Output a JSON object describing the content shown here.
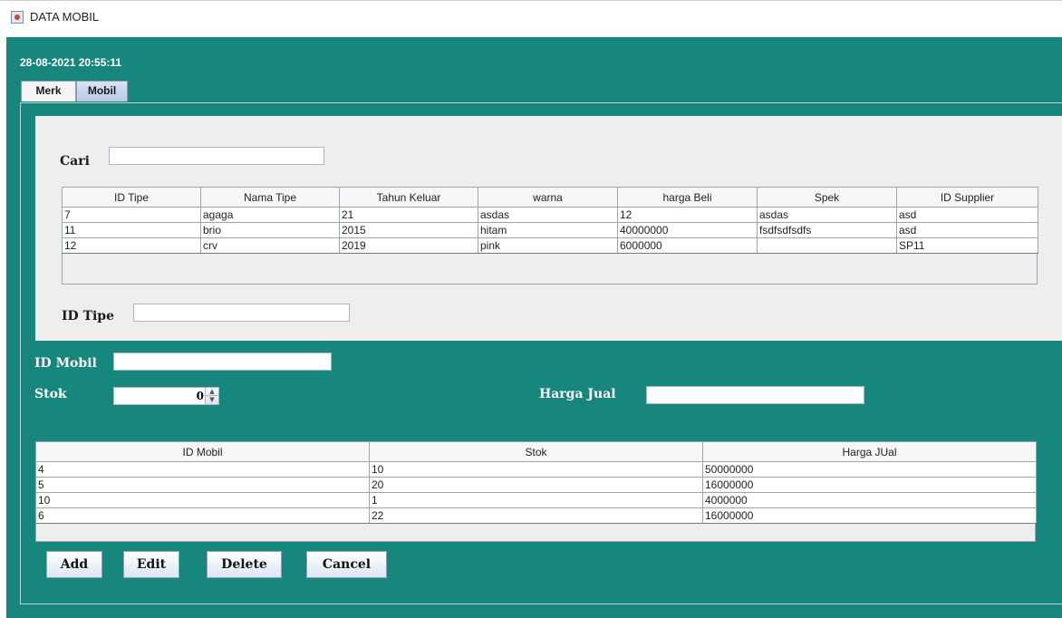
{
  "window": {
    "title": "DATA MOBIL"
  },
  "datetime": "28-08-2021 20:55:11",
  "tabs": [
    {
      "label": "Merk"
    },
    {
      "label": "Mobil"
    }
  ],
  "search": {
    "label": "Cari",
    "value": ""
  },
  "tipe_table": {
    "columns": [
      "ID Tipe",
      "Nama Tipe",
      "Tahun Keluar",
      "warna",
      "harga Beli",
      "Spek",
      "ID Supplier"
    ],
    "rows": [
      [
        "7",
        "agaga",
        "21",
        "asdas",
        "12",
        "asdas",
        "asd"
      ],
      [
        "11",
        "brio",
        "2015",
        "hitam",
        "40000000",
        "fsdfsdfsdfs",
        "asd"
      ],
      [
        "12",
        "crv",
        "2019",
        "pink",
        "6000000",
        "",
        "SP11"
      ]
    ]
  },
  "id_tipe": {
    "label": "ID Tipe",
    "value": ""
  },
  "id_mobil": {
    "label": "ID Mobil",
    "value": ""
  },
  "stok": {
    "label": "Stok",
    "value": "0"
  },
  "harga_jual": {
    "label": "Harga Jual",
    "value": ""
  },
  "mobil_table": {
    "columns": [
      "ID Mobil",
      "Stok",
      "Harga JUal"
    ],
    "rows": [
      [
        "4",
        "10",
        "50000000"
      ],
      [
        "5",
        "20",
        "16000000"
      ],
      [
        "10",
        "1",
        "4000000"
      ],
      [
        "6",
        "22",
        "16000000"
      ]
    ]
  },
  "buttons": {
    "add": "Add",
    "edit": "Edit",
    "delete": "Delete",
    "cancel": "Cancel"
  },
  "colors": {
    "background": "#17867c",
    "panel": "#eeeeee"
  },
  "icons": {
    "app": "java-app-icon",
    "spin_up": "arrow-up-icon",
    "spin_down": "arrow-down-icon"
  }
}
